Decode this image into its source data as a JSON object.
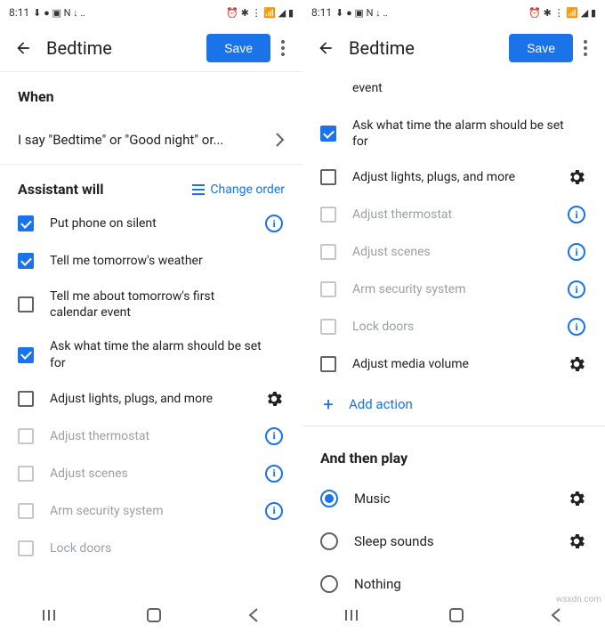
{
  "status": {
    "time": "8:11"
  },
  "appbar": {
    "title": "Bedtime",
    "save": "Save"
  },
  "left": {
    "when_title": "When",
    "trigger_text": "I say \"Bedtime\" or \"Good night\" or...",
    "assist_title": "Assistant will",
    "change_order": "Change order",
    "actions": [
      {
        "label": "Put phone on silent",
        "checked": true,
        "trail": "info",
        "enabled": true
      },
      {
        "label": "Tell me tomorrow's weather",
        "checked": true,
        "trail": "none",
        "enabled": true
      },
      {
        "label": "Tell me about tomorrow's first calendar event",
        "checked": false,
        "trail": "none",
        "enabled": true
      },
      {
        "label": "Ask what time the alarm should be set for",
        "checked": true,
        "trail": "none",
        "enabled": true
      },
      {
        "label": "Adjust lights, plugs, and more",
        "checked": false,
        "trail": "gear",
        "enabled": true
      },
      {
        "label": "Adjust thermostat",
        "checked": false,
        "trail": "info",
        "enabled": false
      },
      {
        "label": "Adjust scenes",
        "checked": false,
        "trail": "info",
        "enabled": false
      },
      {
        "label": "Arm security system",
        "checked": false,
        "trail": "info",
        "enabled": false
      },
      {
        "label": "Lock doors",
        "checked": false,
        "trail": "none",
        "enabled": false
      }
    ]
  },
  "right": {
    "partial_label": "event",
    "actions": [
      {
        "label": "Ask what time the alarm should be set for",
        "checked": true,
        "trail": "none",
        "enabled": true
      },
      {
        "label": "Adjust lights, plugs, and more",
        "checked": false,
        "trail": "gear",
        "enabled": true
      },
      {
        "label": "Adjust thermostat",
        "checked": false,
        "trail": "info",
        "enabled": false
      },
      {
        "label": "Adjust scenes",
        "checked": false,
        "trail": "info",
        "enabled": false
      },
      {
        "label": "Arm security system",
        "checked": false,
        "trail": "info",
        "enabled": false
      },
      {
        "label": "Lock doors",
        "checked": false,
        "trail": "info",
        "enabled": false
      },
      {
        "label": "Adjust media volume",
        "checked": false,
        "trail": "gear",
        "enabled": true
      }
    ],
    "add_action": "Add action",
    "play_title": "And then play",
    "play_options": [
      {
        "label": "Music",
        "checked": true,
        "trail": "gear"
      },
      {
        "label": "Sleep sounds",
        "checked": false,
        "trail": "gear"
      },
      {
        "label": "Nothing",
        "checked": false,
        "trail": "none"
      }
    ]
  },
  "watermark": "wsxdn.com"
}
